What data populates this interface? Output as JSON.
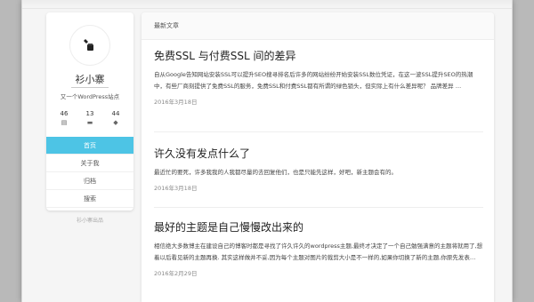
{
  "sidebar": {
    "site_name": "衫小寨",
    "site_desc": "又一个WordPress站点",
    "stats": [
      {
        "count": "46",
        "icon": "document-icon",
        "glyph": "▤"
      },
      {
        "count": "13",
        "icon": "folder-icon",
        "glyph": "▬"
      },
      {
        "count": "44",
        "icon": "tag-icon",
        "glyph": "◆"
      }
    ],
    "nav": [
      {
        "label": "首页",
        "active": true
      },
      {
        "label": "关于我",
        "active": false
      },
      {
        "label": "归档",
        "active": false
      },
      {
        "label": "搜索",
        "active": false
      }
    ],
    "footer": "衫小寨出品"
  },
  "main": {
    "header": "最新文章",
    "posts": [
      {
        "title": "免费SSL 与付费SSL 间的差异",
        "excerpt": "自从Google告知网站安装SSL可以提升SEO搜寻排名后许多的网站纷纷开始安装SSL数位凭证，在这一波SSL提升SEO的热潮中，有些厂商刻提供了免费SSL的服务，免费SSL和付费SSL都有所谓的绿色锁头，但实际上有什么差异呢？ 品牌差异 …",
        "date": "2016年3月18日"
      },
      {
        "title": "许久没有发点什么了",
        "excerpt": "最近忙的要死，许多我我的人我都尽量的去回复他们，也是只能先这样，好吧，新主题会有的。",
        "date": "2016年3月18日"
      },
      {
        "title": "最好的主题是自己慢慢改出来的",
        "excerpt": "相信绝大多数博主在建设自己的博客时都是寻找了许久许久的wordpress主题,最终才决定了一个自己勉强满意的主题将就用了,想着以后看见新的主题再换. 其实这样做并不妥,因为每个主题对图片的裁剪大小是不一样的,如果你切换了新的主题,你原先发表…",
        "date": "2016年2月29日"
      }
    ]
  }
}
